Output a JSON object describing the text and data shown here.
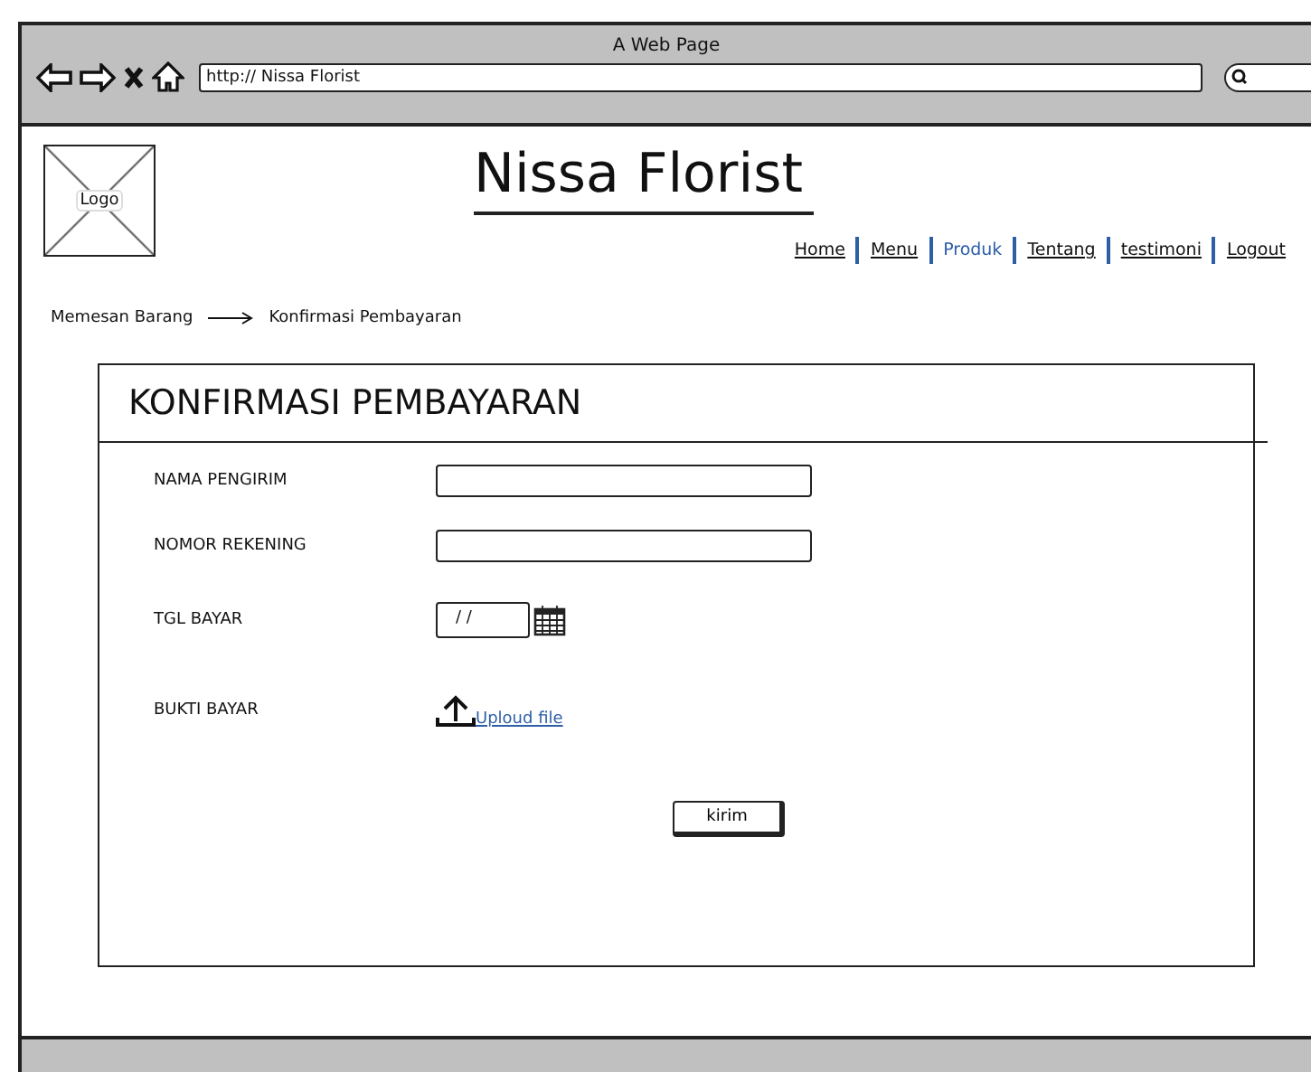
{
  "window": {
    "title": "A Web Page",
    "url": "http:// Nissa Florist"
  },
  "header": {
    "logo": "Logo",
    "site_title": "Nissa Florist"
  },
  "nav": [
    {
      "label": "Home",
      "selected": false
    },
    {
      "label": "Menu",
      "selected": false
    },
    {
      "label": "Produk",
      "selected": true
    },
    {
      "label": "Tentang",
      "selected": false
    },
    {
      "label": "testimoni",
      "selected": false
    },
    {
      "label": "Logout",
      "selected": false
    }
  ],
  "breadcrumb": [
    "Memesan Barang",
    "Konfirmasi Pembayaran"
  ],
  "form": {
    "title": "KONFIRMASI PEMBAYARAN",
    "fields": [
      {
        "kind": "text",
        "label": "NAMA PENGIRIM"
      },
      {
        "kind": "text",
        "label": "NOMOR REKENING"
      },
      {
        "kind": "date",
        "label": "TGL BAYAR",
        "value": "/ /"
      },
      {
        "kind": "upload",
        "label": "BUKTI BAYAR",
        "link": "Uploud file"
      }
    ],
    "submit": "kirim"
  }
}
